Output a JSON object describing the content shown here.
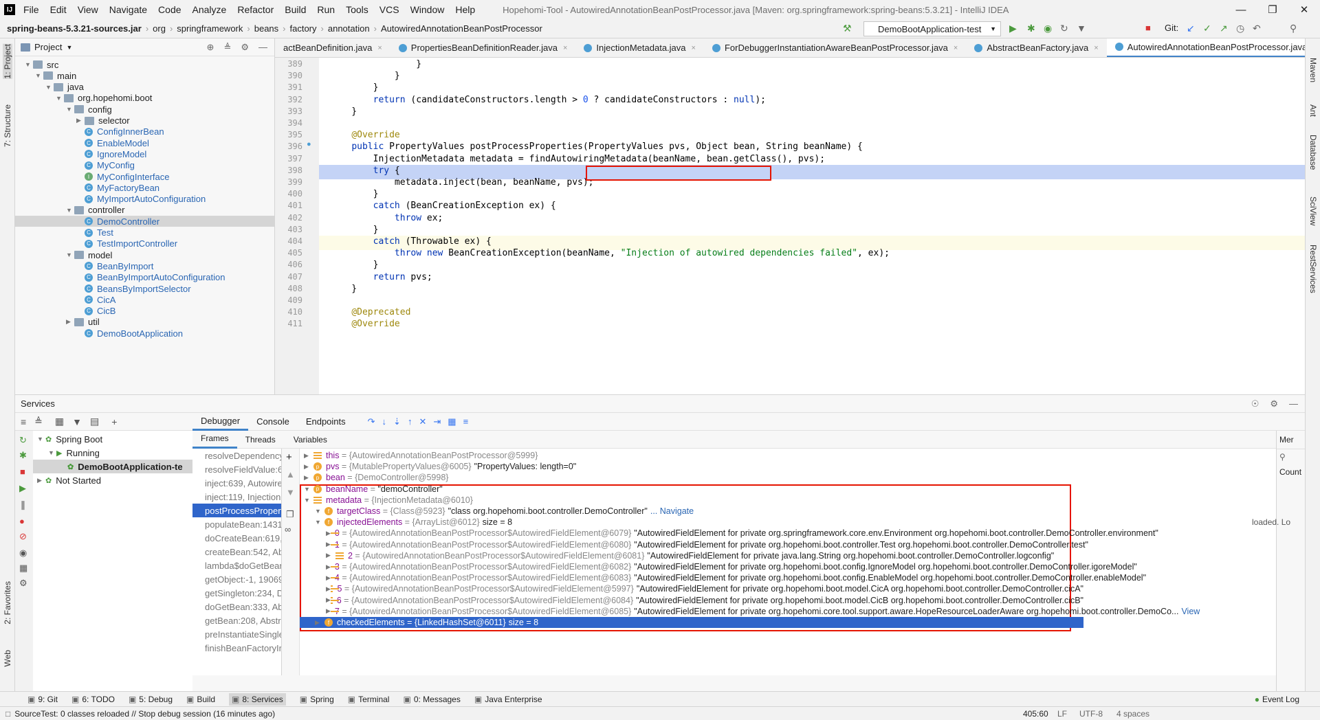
{
  "menubar": {
    "items": [
      "File",
      "Edit",
      "View",
      "Navigate",
      "Code",
      "Analyze",
      "Refactor",
      "Build",
      "Run",
      "Tools",
      "VCS",
      "Window",
      "Help"
    ],
    "title": "Hopehomi-Tool - AutowiredAnnotationBeanPostProcessor.java [Maven: org.springframework:spring-beans:5.3.21] - IntelliJ IDEA"
  },
  "navbar": {
    "crumbs": [
      "spring-beans-5.3.21-sources.jar",
      "org",
      "springframework",
      "beans",
      "factory",
      "annotation",
      "AutowiredAnnotationBeanPostProcessor"
    ],
    "run_config": "DemoBootApplication-test",
    "git_label": "Git:"
  },
  "left_stripe": {
    "project": "1: Project",
    "structure": "7: Structure",
    "favorites": "2: Favorites",
    "web": "Web"
  },
  "right_stripe": {
    "maven": "Maven",
    "ant": "Ant",
    "database": "Database",
    "sciview": "SciView",
    "rest": "RestServices"
  },
  "project": {
    "header": "Project",
    "tree": [
      {
        "label": "src",
        "depth": 0,
        "kind": "folder",
        "expanded": true
      },
      {
        "label": "main",
        "depth": 1,
        "kind": "folder",
        "expanded": true
      },
      {
        "label": "java",
        "depth": 2,
        "kind": "folder",
        "expanded": true
      },
      {
        "label": "org.hopehomi.boot",
        "depth": 3,
        "kind": "folder",
        "expanded": true
      },
      {
        "label": "config",
        "depth": 4,
        "kind": "folder",
        "expanded": true
      },
      {
        "label": "selector",
        "depth": 5,
        "kind": "folder",
        "expanded": false
      },
      {
        "label": "ConfigInnerBean",
        "depth": 5,
        "kind": "class"
      },
      {
        "label": "EnableModel",
        "depth": 5,
        "kind": "class"
      },
      {
        "label": "IgnoreModel",
        "depth": 5,
        "kind": "class"
      },
      {
        "label": "MyConfig",
        "depth": 5,
        "kind": "class"
      },
      {
        "label": "MyConfigInterface",
        "depth": 5,
        "kind": "interface"
      },
      {
        "label": "MyFactoryBean",
        "depth": 5,
        "kind": "class"
      },
      {
        "label": "MyImportAutoConfiguration",
        "depth": 5,
        "kind": "class"
      },
      {
        "label": "controller",
        "depth": 4,
        "kind": "folder",
        "expanded": true
      },
      {
        "label": "DemoController",
        "depth": 5,
        "kind": "class",
        "selected": true
      },
      {
        "label": "Test",
        "depth": 5,
        "kind": "class"
      },
      {
        "label": "TestImportController",
        "depth": 5,
        "kind": "class"
      },
      {
        "label": "model",
        "depth": 4,
        "kind": "folder",
        "expanded": true
      },
      {
        "label": "BeanByImport",
        "depth": 5,
        "kind": "class"
      },
      {
        "label": "BeanByImportAutoConfiguration",
        "depth": 5,
        "kind": "class"
      },
      {
        "label": "BeansByImportSelector",
        "depth": 5,
        "kind": "class"
      },
      {
        "label": "CicA",
        "depth": 5,
        "kind": "class"
      },
      {
        "label": "CicB",
        "depth": 5,
        "kind": "class"
      },
      {
        "label": "util",
        "depth": 4,
        "kind": "folder",
        "expanded": false
      },
      {
        "label": "DemoBootApplication",
        "depth": 5,
        "kind": "class"
      }
    ]
  },
  "tabs": [
    {
      "label": "actBeanDefinition.java",
      "active": false
    },
    {
      "label": "PropertiesBeanDefinitionReader.java",
      "active": false
    },
    {
      "label": "InjectionMetadata.java",
      "active": false
    },
    {
      "label": "ForDebuggerInstantiationAwareBeanPostProcessor.java",
      "active": false
    },
    {
      "label": "AbstractBeanFactory.java",
      "active": false
    },
    {
      "label": "AutowiredAnnotationBeanPostProcessor.java",
      "active": true
    }
  ],
  "editor": {
    "lines": [
      {
        "n": "389",
        "code": "                }"
      },
      {
        "n": "390",
        "code": "            }"
      },
      {
        "n": "391",
        "code": "        }"
      },
      {
        "n": "392",
        "code": "        return (candidateConstructors.length > 0 ? candidateConstructors : null);"
      },
      {
        "n": "393",
        "code": "    }"
      },
      {
        "n": "394",
        "code": ""
      },
      {
        "n": "395",
        "code": "    @Override"
      },
      {
        "n": "396",
        "code": "    public PropertyValues postProcessProperties(PropertyValues pvs, Object bean, String beanName) {"
      },
      {
        "n": "397",
        "code": "        InjectionMetadata metadata = findAutowiringMetadata(beanName, bean.getClass(), pvs);"
      },
      {
        "n": "398",
        "code": "        try {"
      },
      {
        "n": "399",
        "code": "            metadata.inject(bean, beanName, pvs);"
      },
      {
        "n": "400",
        "code": "        }"
      },
      {
        "n": "401",
        "code": "        catch (BeanCreationException ex) {"
      },
      {
        "n": "402",
        "code": "            throw ex;"
      },
      {
        "n": "403",
        "code": "        }"
      },
      {
        "n": "404",
        "code": "        catch (Throwable ex) {"
      },
      {
        "n": "405",
        "code": "            throw new BeanCreationException(beanName, \"Injection of autowired dependencies failed\", ex);"
      },
      {
        "n": "406",
        "code": "        }"
      },
      {
        "n": "407",
        "code": "        return pvs;"
      },
      {
        "n": "408",
        "code": "    }"
      },
      {
        "n": "409",
        "code": ""
      },
      {
        "n": "410",
        "code": "    @Deprecated"
      },
      {
        "n": "411",
        "code": "    @Override"
      }
    ]
  },
  "services": {
    "title": "Services",
    "tree": [
      {
        "label": "Spring Boot",
        "depth": 0
      },
      {
        "label": "Running",
        "depth": 1
      },
      {
        "label": "DemoBootApplication-te",
        "depth": 2,
        "selected": true
      },
      {
        "label": "Not Started",
        "depth": 0
      }
    ],
    "debugger_tabs": [
      "Debugger",
      "Console",
      "Endpoints"
    ],
    "frames_label": "Frames",
    "threads_label": "Threads",
    "variables_label": "Variables",
    "memory_label": "Mer",
    "count_label": "Count",
    "loaded_text": "loaded. Lo",
    "frames": [
      "resolveDependency:",
      "resolveFieldValue:65",
      "inject:639, Autowire",
      "inject:119, Injection",
      "postProcessPropert",
      "populateBean:1431,",
      "doCreateBean:619, A",
      "createBean:542, Abs",
      "lambda$doGetBean",
      "getObject:-1, 19069",
      "getSingleton:234, De",
      "doGetBean:333, Abs",
      "getBean:208, Abstra",
      "preInstantiateSingle",
      "finishBeanFactoryIni"
    ],
    "selected_frame": 4,
    "variables": [
      {
        "depth": 0,
        "badge": "list",
        "name": "this",
        "type": "{AutowiredAnnotationBeanPostProcessor@5999}",
        "value": ""
      },
      {
        "depth": 0,
        "badge": "p",
        "name": "pvs",
        "type": "{MutablePropertyValues@6005}",
        "value": "\"PropertyValues: length=0\""
      },
      {
        "depth": 0,
        "badge": "p",
        "name": "bean",
        "type": "{DemoController@5998}",
        "value": ""
      },
      {
        "depth": 0,
        "badge": "p",
        "name": "beanName",
        "type": "",
        "value": "\"demoController\""
      },
      {
        "depth": 0,
        "badge": "list",
        "name": "metadata",
        "type": "{InjectionMetadata@6010}",
        "value": ""
      },
      {
        "depth": 1,
        "badge": "f",
        "name": "targetClass",
        "type": "{Class@5923}",
        "value": "\"class org.hopehomi.boot.controller.DemoController\"",
        "link": "... Navigate"
      },
      {
        "depth": 1,
        "badge": "f",
        "name": "injectedElements",
        "type": "{ArrayList@6012}",
        "value": "size = 8"
      },
      {
        "depth": 2,
        "badge": "list",
        "name": "0",
        "type": "{AutowiredAnnotationBeanPostProcessor$AutowiredFieldElement@6079}",
        "value": "\"AutowiredFieldElement for private org.springframework.core.env.Environment org.hopehomi.boot.controller.DemoController.environment\""
      },
      {
        "depth": 2,
        "badge": "list",
        "name": "1",
        "type": "{AutowiredAnnotationBeanPostProcessor$AutowiredFieldElement@6080}",
        "value": "\"AutowiredFieldElement for private org.hopehomi.boot.controller.Test org.hopehomi.boot.controller.DemoController.test\""
      },
      {
        "depth": 2,
        "badge": "list",
        "name": "2",
        "type": "{AutowiredAnnotationBeanPostProcessor$AutowiredFieldElement@6081}",
        "value": "\"AutowiredFieldElement for private java.lang.String org.hopehomi.boot.controller.DemoController.logconfig\""
      },
      {
        "depth": 2,
        "badge": "list",
        "name": "3",
        "type": "{AutowiredAnnotationBeanPostProcessor$AutowiredFieldElement@6082}",
        "value": "\"AutowiredFieldElement for private org.hopehomi.boot.config.IgnoreModel org.hopehomi.boot.controller.DemoController.igoreModel\""
      },
      {
        "depth": 2,
        "badge": "list",
        "name": "4",
        "type": "{AutowiredAnnotationBeanPostProcessor$AutowiredFieldElement@6083}",
        "value": "\"AutowiredFieldElement for private org.hopehomi.boot.config.EnableModel org.hopehomi.boot.controller.DemoController.enableModel\""
      },
      {
        "depth": 2,
        "badge": "list",
        "name": "5",
        "type": "{AutowiredAnnotationBeanPostProcessor$AutowiredFieldElement@5997}",
        "value": "\"AutowiredFieldElement for private org.hopehomi.boot.model.CicA org.hopehomi.boot.controller.DemoController.cicA\""
      },
      {
        "depth": 2,
        "badge": "list",
        "name": "6",
        "type": "{AutowiredAnnotationBeanPostProcessor$AutowiredFieldElement@6084}",
        "value": "\"AutowiredFieldElement for private org.hopehomi.boot.model.CicB org.hopehomi.boot.controller.DemoController.cicB\""
      },
      {
        "depth": 2,
        "badge": "list",
        "name": "7",
        "type": "{AutowiredAnnotationBeanPostProcessor$AutowiredFieldElement@6085}",
        "value": "\"AutowiredFieldElement for private org.hopehomi.core.tool.support.aware.HopeResourceLoaderAware org.hopehomi.boot.controller.DemoCo...",
        "link": "View"
      },
      {
        "depth": 1,
        "badge": "f",
        "name": "checkedElements",
        "type": "{LinkedHashSet@6011}",
        "value": "size = 8",
        "selected": true
      }
    ]
  },
  "toolwindows": [
    {
      "label": "9: Git"
    },
    {
      "label": "6: TODO"
    },
    {
      "label": "5: Debug"
    },
    {
      "label": "Build"
    },
    {
      "label": "8: Services",
      "active": true
    },
    {
      "label": "Spring"
    },
    {
      "label": "Terminal"
    },
    {
      "label": "0: Messages"
    },
    {
      "label": "Java Enterprise"
    }
  ],
  "event_log": "Event Log",
  "status": {
    "message": "SourceTest: 0 classes reloaded // Stop debug session (16 minutes ago)",
    "position": "405:60",
    "line_sep": "LF",
    "encoding": "UTF-8",
    "indent": "4 spaces"
  },
  "colors": {
    "accent": "#2f65ca",
    "highlight_line": "#c4d3f6",
    "red_box": "#e51400"
  }
}
